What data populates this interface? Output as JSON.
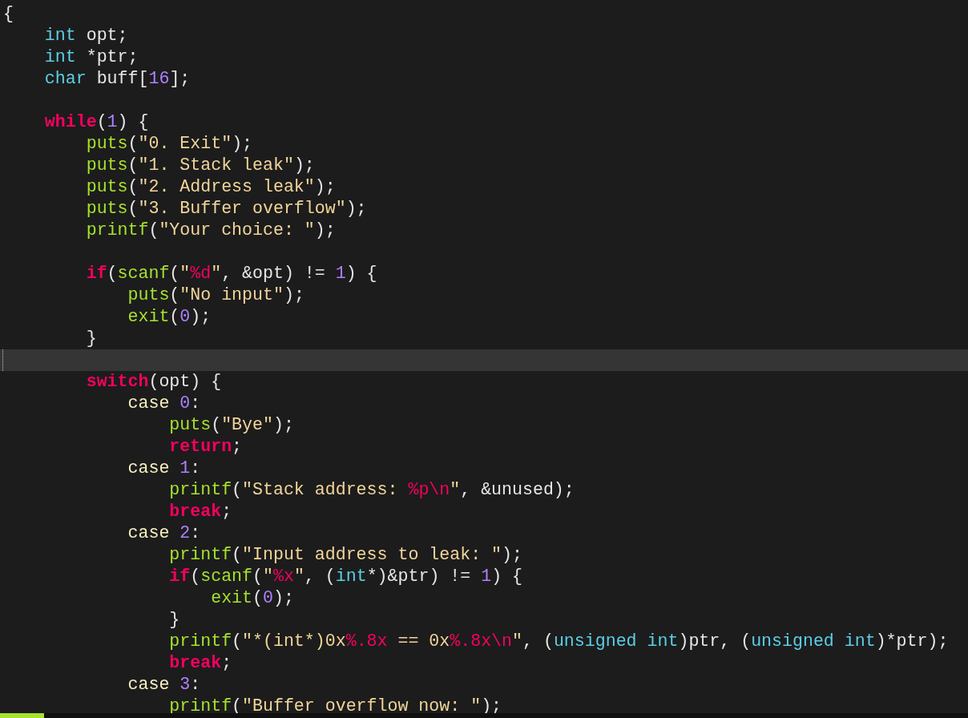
{
  "editor": {
    "lines": [
      {
        "current": false,
        "tokens": [
          {
            "kind": "plain",
            "text": "{"
          }
        ]
      },
      {
        "current": false,
        "tokens": [
          {
            "kind": "type",
            "text": "    int"
          },
          {
            "kind": "plain",
            "text": " opt;"
          }
        ]
      },
      {
        "current": false,
        "tokens": [
          {
            "kind": "type",
            "text": "    int"
          },
          {
            "kind": "plain",
            "text": " *ptr;"
          }
        ]
      },
      {
        "current": false,
        "tokens": [
          {
            "kind": "type",
            "text": "    char"
          },
          {
            "kind": "plain",
            "text": " buff["
          },
          {
            "kind": "number",
            "text": "16"
          },
          {
            "kind": "plain",
            "text": "];"
          }
        ]
      },
      {
        "current": false
      },
      {
        "current": false,
        "tokens": [
          {
            "kind": "keyword",
            "text": "    while"
          },
          {
            "kind": "plain",
            "text": "("
          },
          {
            "kind": "number",
            "text": "1"
          },
          {
            "kind": "plain",
            "text": ") {"
          }
        ]
      },
      {
        "current": false,
        "tokens": [
          {
            "kind": "function",
            "text": "        puts"
          },
          {
            "kind": "plain",
            "text": "("
          },
          {
            "kind": "string",
            "text": "\"0. Exit\""
          },
          {
            "kind": "plain",
            "text": ");"
          }
        ]
      },
      {
        "current": false,
        "tokens": [
          {
            "kind": "function",
            "text": "        puts"
          },
          {
            "kind": "plain",
            "text": "("
          },
          {
            "kind": "string",
            "text": "\"1. Stack leak\""
          },
          {
            "kind": "plain",
            "text": ");"
          }
        ]
      },
      {
        "current": false,
        "tokens": [
          {
            "kind": "function",
            "text": "        puts"
          },
          {
            "kind": "plain",
            "text": "("
          },
          {
            "kind": "string",
            "text": "\"2. Address leak\""
          },
          {
            "kind": "plain",
            "text": ");"
          }
        ]
      },
      {
        "current": false,
        "tokens": [
          {
            "kind": "function",
            "text": "        puts"
          },
          {
            "kind": "plain",
            "text": "("
          },
          {
            "kind": "string",
            "text": "\"3. Buffer overflow\""
          },
          {
            "kind": "plain",
            "text": ");"
          }
        ]
      },
      {
        "current": false,
        "tokens": [
          {
            "kind": "function",
            "text": "        printf"
          },
          {
            "kind": "plain",
            "text": "("
          },
          {
            "kind": "string",
            "text": "\"Your choice: \""
          },
          {
            "kind": "plain",
            "text": ");"
          }
        ]
      },
      {
        "current": false
      },
      {
        "current": false,
        "tokens": [
          {
            "kind": "keyword",
            "text": "        if"
          },
          {
            "kind": "plain",
            "text": "("
          },
          {
            "kind": "function",
            "text": "scanf"
          },
          {
            "kind": "plain",
            "text": "("
          },
          {
            "kind": "string",
            "text": "\""
          },
          {
            "kind": "format",
            "text": "%d"
          },
          {
            "kind": "string",
            "text": "\""
          },
          {
            "kind": "plain",
            "text": ", &opt) != "
          },
          {
            "kind": "number",
            "text": "1"
          },
          {
            "kind": "plain",
            "text": ") {"
          }
        ]
      },
      {
        "current": false,
        "tokens": [
          {
            "kind": "function",
            "text": "            puts"
          },
          {
            "kind": "plain",
            "text": "("
          },
          {
            "kind": "string",
            "text": "\"No input\""
          },
          {
            "kind": "plain",
            "text": ");"
          }
        ]
      },
      {
        "current": false,
        "tokens": [
          {
            "kind": "function",
            "text": "            exit"
          },
          {
            "kind": "plain",
            "text": "("
          },
          {
            "kind": "number",
            "text": "0"
          },
          {
            "kind": "plain",
            "text": ");"
          }
        ]
      },
      {
        "current": false,
        "tokens": [
          {
            "kind": "plain",
            "text": "        }"
          }
        ]
      },
      {
        "current": true
      },
      {
        "current": false,
        "tokens": [
          {
            "kind": "keyword",
            "text": "        switch"
          },
          {
            "kind": "plain",
            "text": "(opt) {"
          }
        ]
      },
      {
        "current": false,
        "tokens": [
          {
            "kind": "label",
            "text": "            case"
          },
          {
            "kind": "number",
            "text": " 0"
          },
          {
            "kind": "plain",
            "text": ":"
          }
        ]
      },
      {
        "current": false,
        "tokens": [
          {
            "kind": "function",
            "text": "                puts"
          },
          {
            "kind": "plain",
            "text": "("
          },
          {
            "kind": "string",
            "text": "\"Bye\""
          },
          {
            "kind": "plain",
            "text": ");"
          }
        ]
      },
      {
        "current": false,
        "tokens": [
          {
            "kind": "keyword",
            "text": "                return"
          },
          {
            "kind": "plain",
            "text": ";"
          }
        ]
      },
      {
        "current": false,
        "tokens": [
          {
            "kind": "label",
            "text": "            case"
          },
          {
            "kind": "number",
            "text": " 1"
          },
          {
            "kind": "plain",
            "text": ":"
          }
        ]
      },
      {
        "current": false,
        "tokens": [
          {
            "kind": "function",
            "text": "                printf"
          },
          {
            "kind": "plain",
            "text": "("
          },
          {
            "kind": "string",
            "text": "\"Stack address: "
          },
          {
            "kind": "format",
            "text": "%p\\n"
          },
          {
            "kind": "string",
            "text": "\""
          },
          {
            "kind": "plain",
            "text": ", &unused);"
          }
        ]
      },
      {
        "current": false,
        "tokens": [
          {
            "kind": "keyword",
            "text": "                break"
          },
          {
            "kind": "plain",
            "text": ";"
          }
        ]
      },
      {
        "current": false,
        "tokens": [
          {
            "kind": "label",
            "text": "            case"
          },
          {
            "kind": "number",
            "text": " 2"
          },
          {
            "kind": "plain",
            "text": ":"
          }
        ]
      },
      {
        "current": false,
        "tokens": [
          {
            "kind": "function",
            "text": "                printf"
          },
          {
            "kind": "plain",
            "text": "("
          },
          {
            "kind": "string",
            "text": "\"Input address to leak: \""
          },
          {
            "kind": "plain",
            "text": ");"
          }
        ]
      },
      {
        "current": false,
        "tokens": [
          {
            "kind": "keyword",
            "text": "                if"
          },
          {
            "kind": "plain",
            "text": "("
          },
          {
            "kind": "function",
            "text": "scanf"
          },
          {
            "kind": "plain",
            "text": "("
          },
          {
            "kind": "string",
            "text": "\""
          },
          {
            "kind": "format",
            "text": "%x"
          },
          {
            "kind": "string",
            "text": "\""
          },
          {
            "kind": "plain",
            "text": ", ("
          },
          {
            "kind": "type",
            "text": "int"
          },
          {
            "kind": "plain",
            "text": "*)&ptr) != "
          },
          {
            "kind": "number",
            "text": "1"
          },
          {
            "kind": "plain",
            "text": ") {"
          }
        ]
      },
      {
        "current": false,
        "tokens": [
          {
            "kind": "function",
            "text": "                    exit"
          },
          {
            "kind": "plain",
            "text": "("
          },
          {
            "kind": "number",
            "text": "0"
          },
          {
            "kind": "plain",
            "text": ");"
          }
        ]
      },
      {
        "current": false,
        "tokens": [
          {
            "kind": "plain",
            "text": "                }"
          }
        ]
      },
      {
        "current": false,
        "tokens": [
          {
            "kind": "function",
            "text": "                printf"
          },
          {
            "kind": "plain",
            "text": "("
          },
          {
            "kind": "string",
            "text": "\"*(int*)0x"
          },
          {
            "kind": "format",
            "text": "%.8x"
          },
          {
            "kind": "string",
            "text": " == 0x"
          },
          {
            "kind": "format",
            "text": "%.8x\\n"
          },
          {
            "kind": "string",
            "text": "\""
          },
          {
            "kind": "plain",
            "text": ", ("
          },
          {
            "kind": "type",
            "text": "unsigned int"
          },
          {
            "kind": "plain",
            "text": ")ptr, ("
          },
          {
            "kind": "type",
            "text": "unsigned int"
          },
          {
            "kind": "plain",
            "text": ")*ptr);"
          }
        ]
      },
      {
        "current": false,
        "tokens": [
          {
            "kind": "keyword",
            "text": "                break"
          },
          {
            "kind": "plain",
            "text": ";"
          }
        ]
      },
      {
        "current": false,
        "tokens": [
          {
            "kind": "label",
            "text": "            case"
          },
          {
            "kind": "number",
            "text": " 3"
          },
          {
            "kind": "plain",
            "text": ":"
          }
        ]
      },
      {
        "current": false,
        "tokens": [
          {
            "kind": "function",
            "text": "                printf"
          },
          {
            "kind": "plain",
            "text": "("
          },
          {
            "kind": "string",
            "text": "\"Buffer overflow now: \""
          },
          {
            "kind": "plain",
            "text": ");"
          }
        ]
      }
    ]
  }
}
